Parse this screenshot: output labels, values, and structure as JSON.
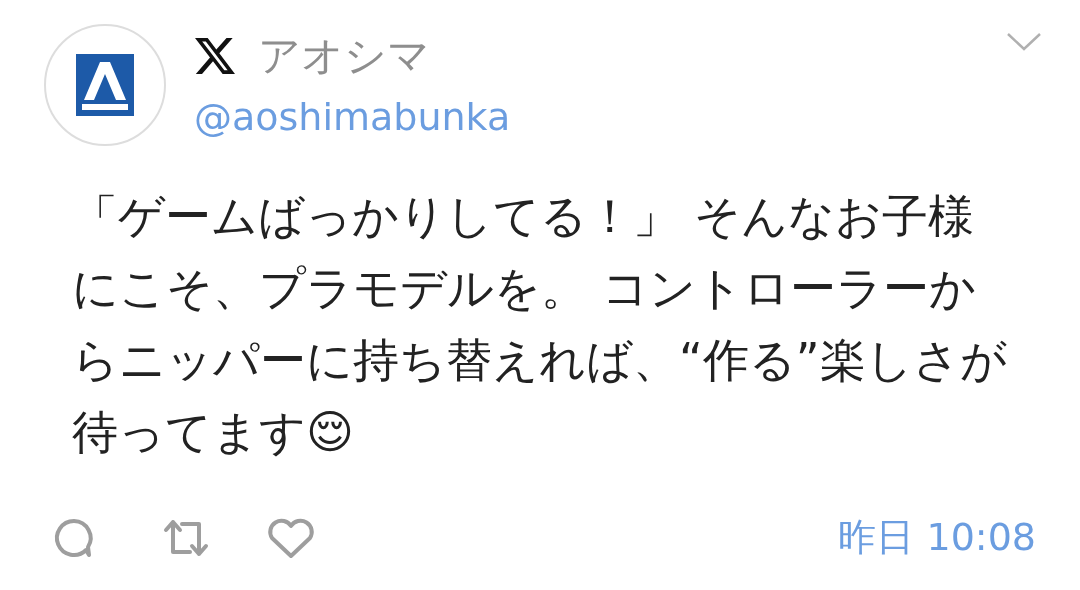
{
  "author": {
    "name": "アオシマ",
    "handle": "@aoshimabunka"
  },
  "tweet": {
    "text": "「ゲームばっかりしてる！」 そんなお子様にこそ、プラモデルを。 コントローラーからニッパーに持ち替えれば、“作る”楽しさが待ってます😌"
  },
  "footer": {
    "timestamp": "昨日 10:08"
  }
}
